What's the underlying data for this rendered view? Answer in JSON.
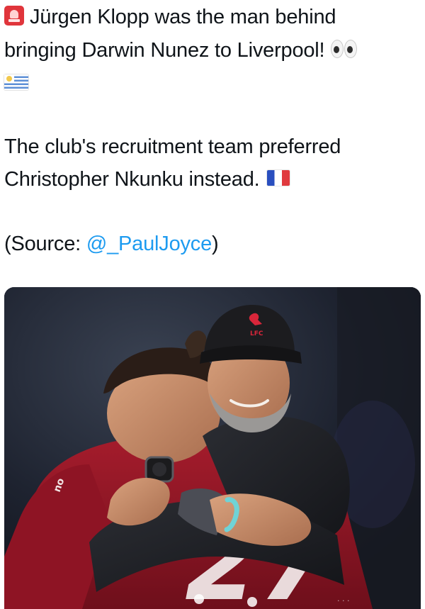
{
  "tweet": {
    "headline_1": "Jürgen Klopp was the man behind",
    "headline_2": "bringing Darwin Nunez to Liverpool!",
    "paragraph_1": "The club's recruitment team preferred",
    "paragraph_2": "Christopher Nkunku instead.",
    "source_prefix": "(Source: ",
    "source_mention": "@_PaulJoyce",
    "source_suffix": ")"
  },
  "emojis": {
    "headline_lead": "police-light-icon",
    "headline_trail": "eyes-icon",
    "country_flag": "uruguay-flag-icon",
    "paragraph_flag": "france-flag-icon"
  },
  "photo": {
    "cap_badge": "LFC",
    "shirt_number": "27",
    "shirt_text": "no"
  },
  "colors": {
    "mention": "#1d9bf0",
    "text": "#0f1419",
    "kit_red": "#8e1424",
    "cap": "#1c1c1f"
  }
}
